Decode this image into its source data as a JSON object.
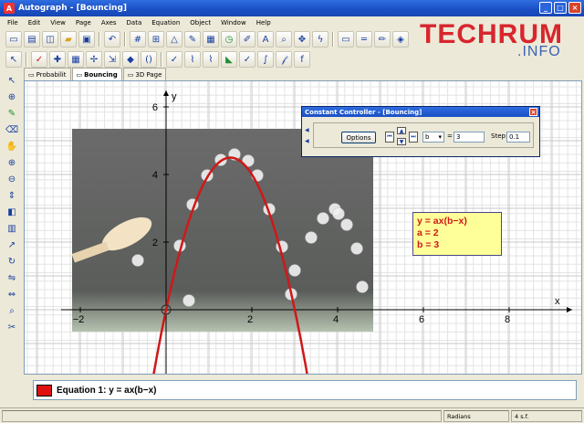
{
  "window": {
    "title": "Autograph - [Bouncing]"
  },
  "menu": [
    "File",
    "Edit",
    "View",
    "Page",
    "Axes",
    "Data",
    "Equation",
    "Object",
    "Window",
    "Help"
  ],
  "brand": {
    "main": "TECHRUM",
    "sub": ".INFO"
  },
  "tabs": [
    {
      "label": "Probabilit",
      "active": false
    },
    {
      "label": "Bouncing",
      "active": true
    },
    {
      "label": "3D Page",
      "active": false
    }
  ],
  "graph": {
    "axis_x_label": "x",
    "axis_y_label": "y",
    "x_ticks": [
      "−2",
      "2",
      "4",
      "6",
      "8"
    ],
    "y_ticks": [
      "6",
      "4",
      "2"
    ],
    "curve_color": "#d01818"
  },
  "controller": {
    "title": "Constant Controller - [Bouncing]",
    "options_label": "Options",
    "constant": "b",
    "equals": "=",
    "value": "3",
    "step_label": "Step:",
    "step_value": "0.1"
  },
  "eqbox": {
    "line1": "y = ax(b−x)",
    "line2": "a = 2",
    "line3": "b = 3"
  },
  "equation_bar": {
    "text": "Equation 1: y = ax(b−x)",
    "swatch_color": "#e01010"
  },
  "status": {
    "angle": "Radians",
    "sig_figs": "4 s.f."
  }
}
